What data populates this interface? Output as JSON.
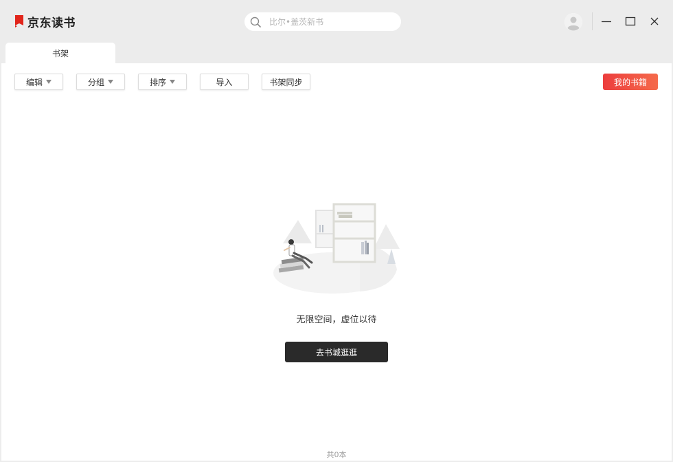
{
  "app": {
    "brand": "京东读书",
    "brand_color": "#e1251b"
  },
  "search": {
    "placeholder": "比尔•盖茨新书",
    "icon": "search-icon"
  },
  "window_controls": [
    "minimize-icon",
    "maximize-icon",
    "close-icon"
  ],
  "tabs": [
    {
      "label": "书架",
      "active": true
    }
  ],
  "toolbar": {
    "edit_label": "编辑",
    "group_label": "分组",
    "sort_label": "排序",
    "import_label": "导入",
    "sync_label": "书架同步",
    "my_books_label": "我的书籍"
  },
  "empty_state": {
    "message": "无限空间，虚位以待",
    "button_label": "去书城逛逛"
  },
  "footer": {
    "count_text": "共0本"
  },
  "colors": {
    "accent_gradient_start": "#ec3d3d",
    "accent_gradient_end": "#f56a4b",
    "primary_dark": "#2a2a2a"
  }
}
